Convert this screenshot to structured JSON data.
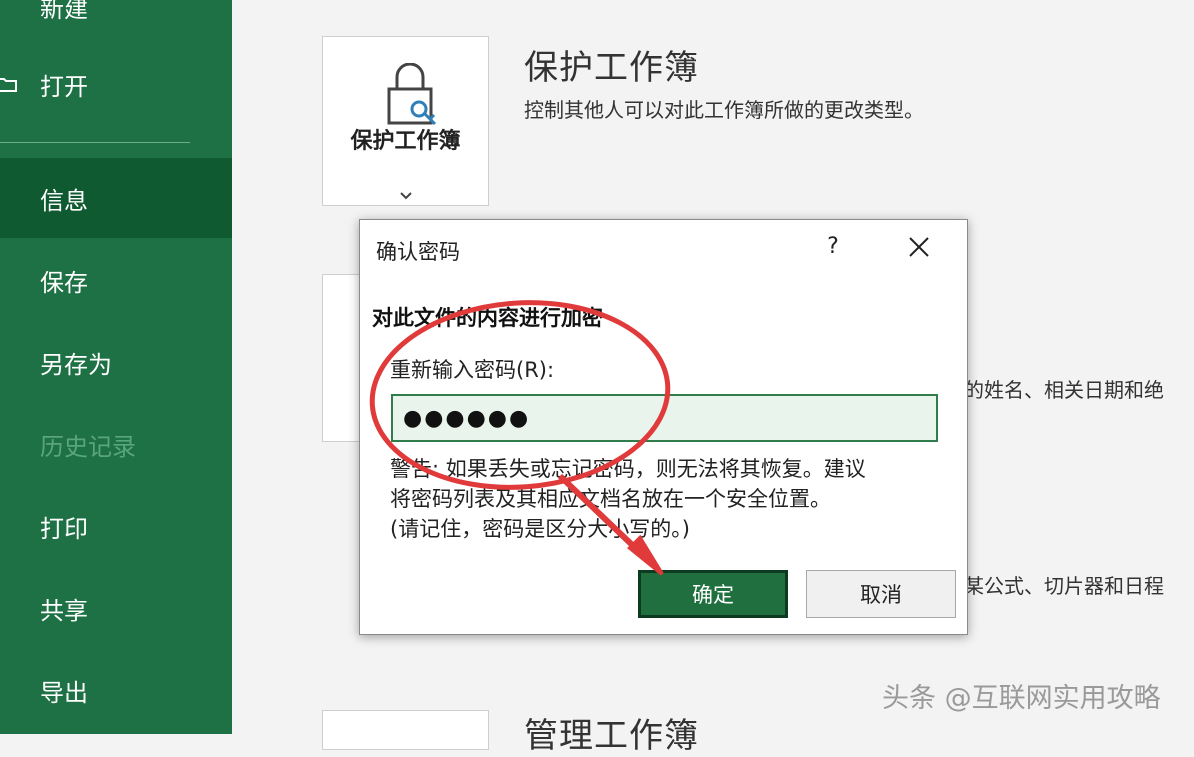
{
  "nav": {
    "items": [
      {
        "label": "新建"
      },
      {
        "label": "打开"
      },
      {
        "label": "信息"
      },
      {
        "label": "保存"
      },
      {
        "label": "另存为"
      },
      {
        "label": "历史记录"
      },
      {
        "label": "打印"
      },
      {
        "label": "共享"
      },
      {
        "label": "导出"
      }
    ],
    "active": "信息"
  },
  "protect": {
    "tile_label": "保护工作簿",
    "title": "保护工作簿",
    "description": "控制其他人可以对此工作簿所做的更改类型。"
  },
  "inspect": {
    "description_fragment": "的姓名、相关日期和绝"
  },
  "browser": {
    "description_fragment": "某公式、切片器和日程"
  },
  "manage": {
    "title": "管理工作簿"
  },
  "dialog": {
    "title": "确认密码",
    "help": "?",
    "heading": "对此文件的内容进行加密",
    "reenter_label": "重新输入密码(R):",
    "password_value": "●●●●●●",
    "warning_lines": [
      "警告: 如果丢失或忘记密码，则无法将其恢复。建议",
      "将密码列表及其相应文档名放在一个安全位置。",
      "(请记住，密码是区分大小写的。)"
    ],
    "ok_label": "确定",
    "cancel_label": "取消"
  },
  "watermark": "头条 @互联网实用攻略",
  "colors": {
    "nav_bg": "#1e7145",
    "nav_active": "#0f5a31",
    "ok_button": "#1f6f3f",
    "annotation": "#e03a3a"
  }
}
